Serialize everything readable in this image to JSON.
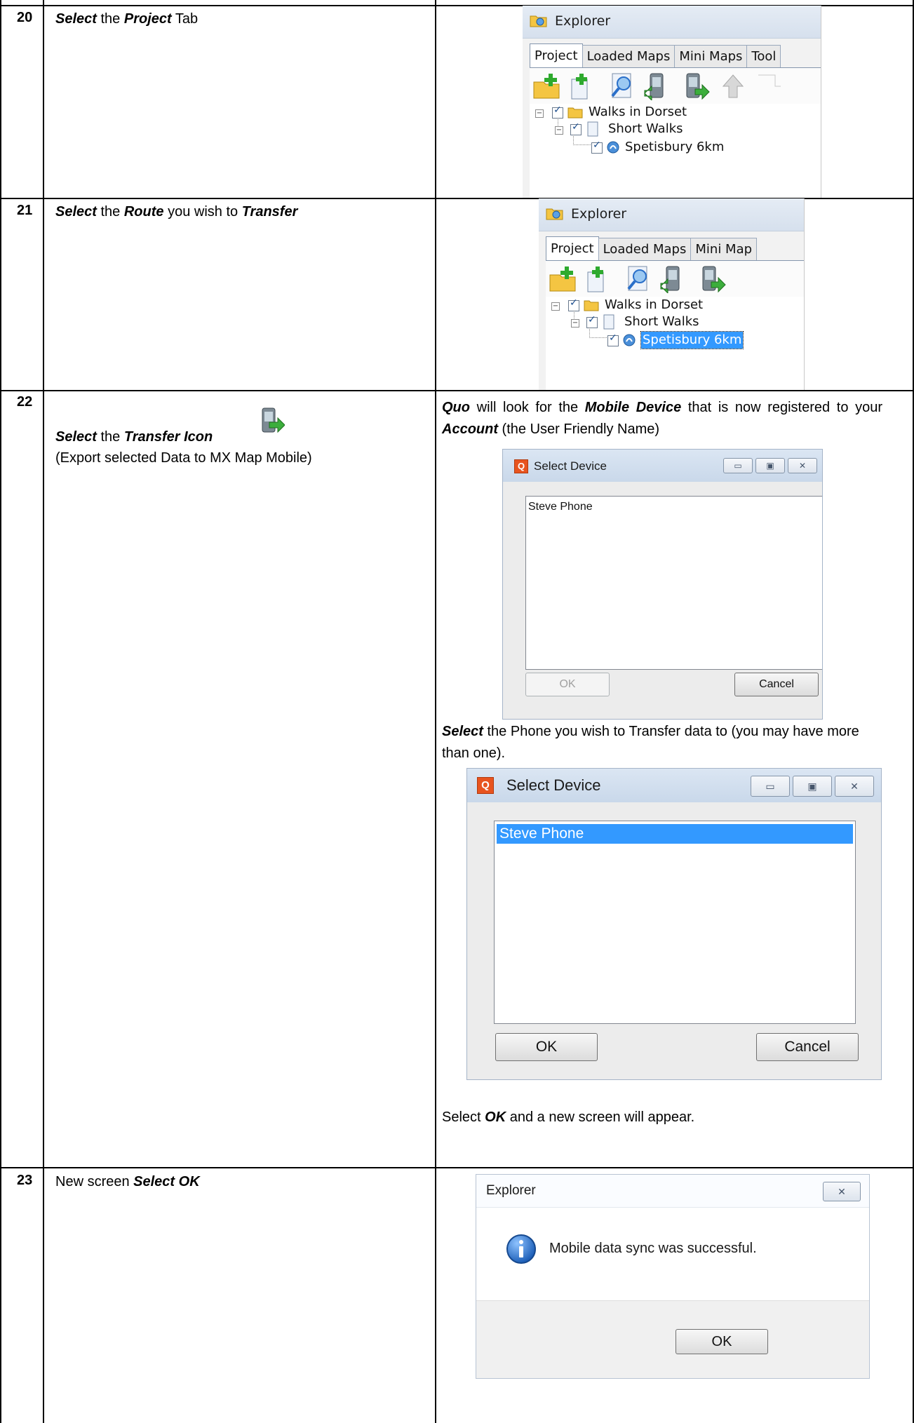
{
  "rows": [
    {
      "number": "20"
    },
    {
      "number": "21"
    },
    {
      "number": "22"
    },
    {
      "number": "23"
    }
  ],
  "row20": {
    "w1": "Select",
    "w2": " the ",
    "w3": "Project",
    "w4": " Tab"
  },
  "row21": {
    "w1": "Select",
    "w2": " the ",
    "w3": "Route",
    "w4": " you wish to ",
    "w5": "Transfer"
  },
  "row22": {
    "w1": "Select",
    "w2": " the ",
    "w3": "Transfer Icon",
    "sub": "(Export selected Data to MX Map Mobile)",
    "p1": {
      "a": "Quo",
      "b": " will look for the ",
      "c": "Mobile Device",
      "d": " that is now registered to your ",
      "e": "Account",
      "f": " (the User Friendly Name)"
    },
    "p2": {
      "a": "Select",
      "b": " the Phone you wish to Transfer data to (you may have more than one)."
    },
    "p3": {
      "a": "Select ",
      "b": "OK",
      "c": " and a new screen will appear."
    }
  },
  "row23": {
    "w1": "New screen ",
    "w2": "Select OK"
  },
  "explorer": {
    "title": "Explorer",
    "tabs_a": [
      "Project",
      "Loaded Maps",
      "Mini Maps",
      "Tool"
    ],
    "tabs_b": [
      "Project",
      "Loaded Maps",
      "Mini Map"
    ],
    "tree": {
      "project": "Walks in Dorset",
      "folder": "Short Walks",
      "route": "Spetisbury 6km"
    }
  },
  "select_device": {
    "title": "Select Device",
    "item": "Steve Phone",
    "ok": "OK",
    "cancel": "Cancel",
    "min": "▭",
    "max": "▣",
    "close": "✕"
  },
  "message": {
    "title": "Explorer",
    "text": "Mobile data sync was successful.",
    "ok": "OK",
    "close": "✕"
  },
  "colors": {
    "selection": "#3399ff",
    "info_icon": "#2a6fc9",
    "quo_logo": "#e8541f"
  }
}
